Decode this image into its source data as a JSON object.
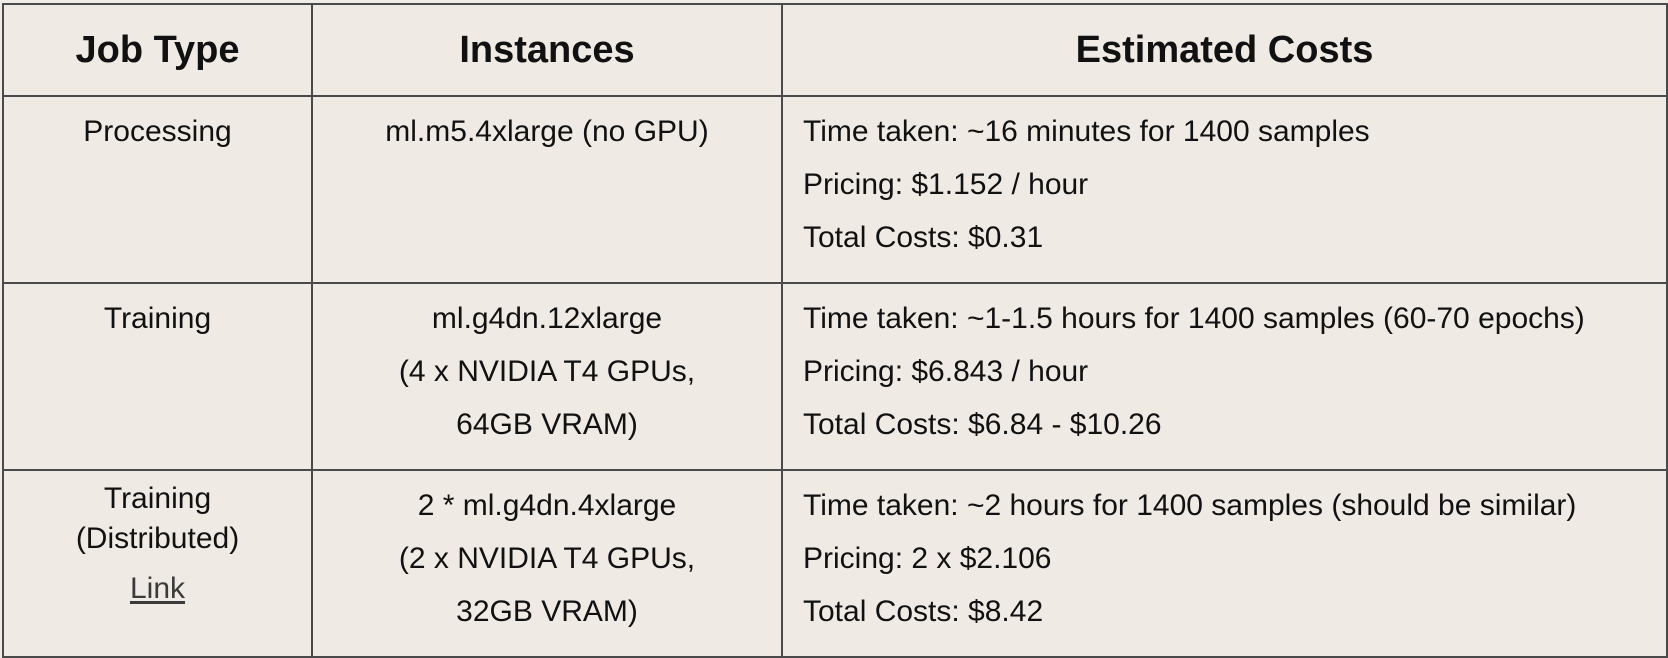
{
  "headers": {
    "job_type": "Job Type",
    "instances": "Instances",
    "estimated_costs": "Estimated Costs"
  },
  "rows": [
    {
      "job_type": [
        "Processing"
      ],
      "instances": [
        "ml.m5.4xlarge (no GPU)"
      ],
      "costs": [
        "Time taken: ~16 minutes for 1400 samples",
        "Pricing: $1.152 / hour",
        "Total Costs: $0.31"
      ]
    },
    {
      "job_type": [
        "Training"
      ],
      "instances": [
        "ml.g4dn.12xlarge",
        "(4 x NVIDIA T4 GPUs,",
        "64GB VRAM)"
      ],
      "costs": [
        "Time taken: ~1-1.5 hours for 1400 samples (60-70 epochs)",
        "Pricing: $6.843 / hour",
        "Total Costs: $6.84 - $10.26"
      ]
    },
    {
      "job_type": [
        "Training",
        "(Distributed)"
      ],
      "job_link": "Link",
      "instances": [
        "2 * ml.g4dn.4xlarge",
        "(2 x NVIDIA T4 GPUs,",
        "32GB VRAM)"
      ],
      "costs": [
        "Time taken: ~2 hours for 1400 samples (should be similar)",
        "Pricing: 2 x $2.106",
        "Total Costs: $8.42"
      ]
    }
  ],
  "colors": {
    "background": "#efeae3",
    "border": "#4a4a4a",
    "text": "#111111",
    "link": "#3b3b3b"
  }
}
